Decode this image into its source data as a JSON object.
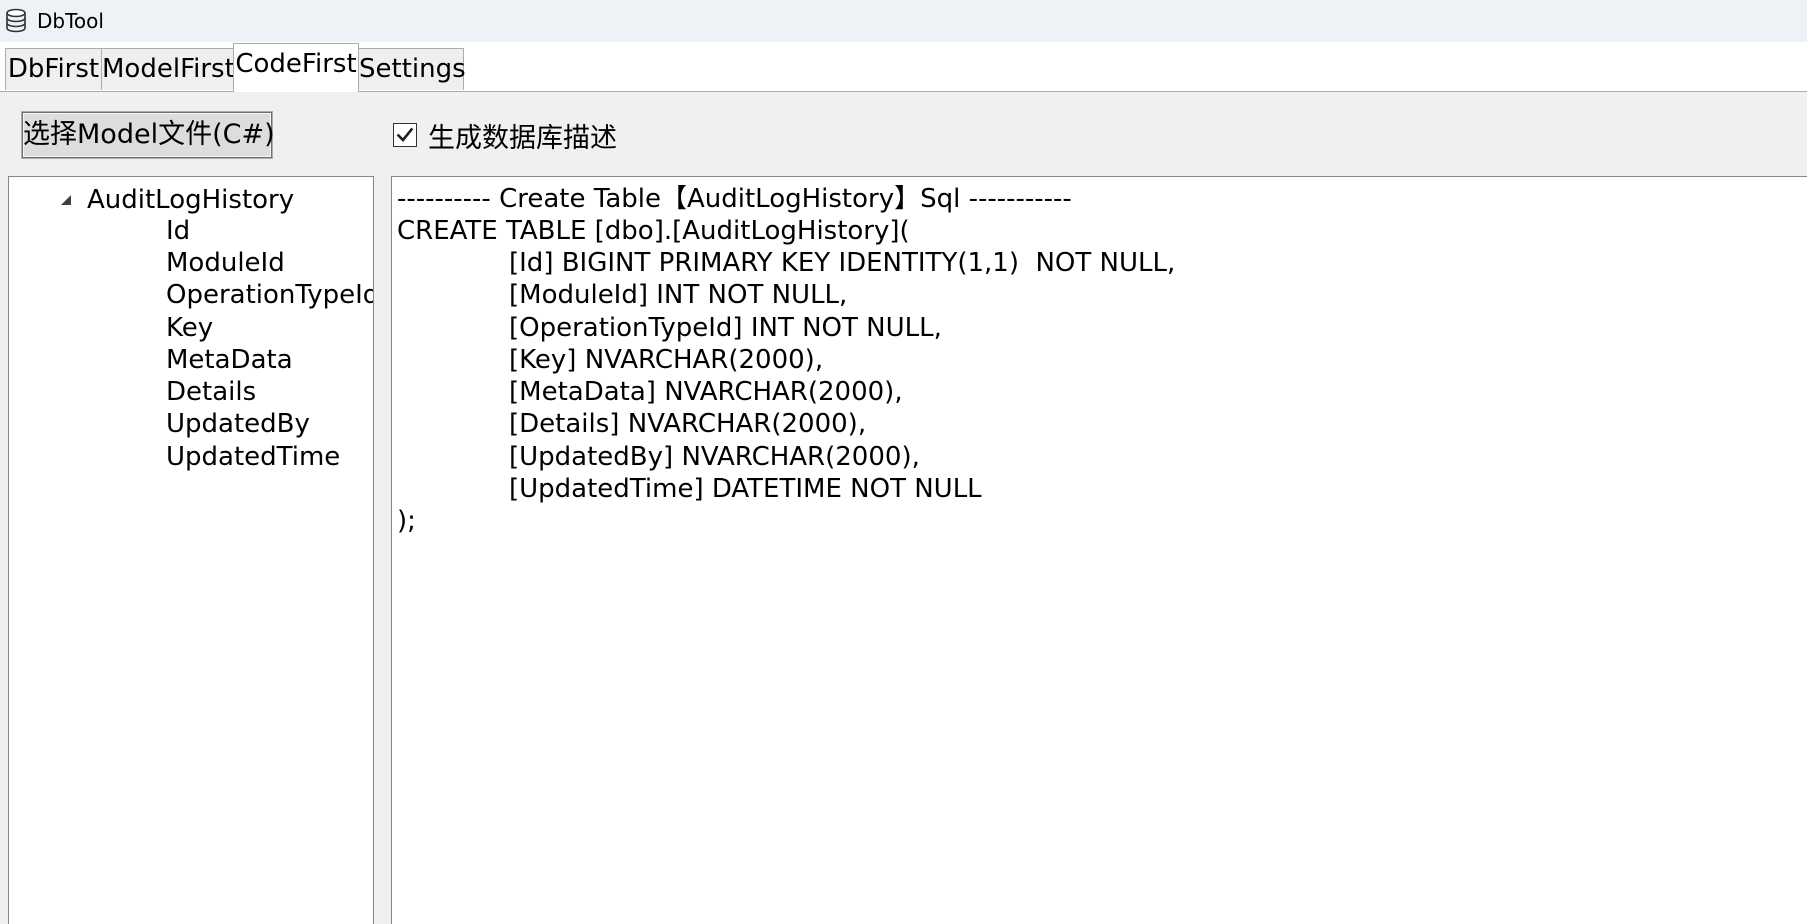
{
  "window": {
    "title": "DbTool",
    "icon": "database-stack-icon"
  },
  "tabs": [
    {
      "label": "DbFirst",
      "active": false
    },
    {
      "label": "ModelFirst",
      "active": false
    },
    {
      "label": "CodeFirst",
      "active": true
    },
    {
      "label": "Settings",
      "active": false
    }
  ],
  "toolbar": {
    "select_model_button": "选择Model文件(C#)",
    "generate_description_checkbox": {
      "label": "生成数据库描述",
      "checked": true
    }
  },
  "tree": {
    "root": {
      "label": "AuditLogHistory",
      "expanded": true,
      "children": [
        "Id",
        "ModuleId",
        "OperationTypeId",
        "Key",
        "MetaData",
        "Details",
        "UpdatedBy",
        "UpdatedTime"
      ]
    }
  },
  "sql_output": {
    "lines": [
      "---------- Create Table【AuditLogHistory】Sql -----------",
      "CREATE TABLE [dbo].[AuditLogHistory](",
      "[Id] BIGINT PRIMARY KEY IDENTITY(1,1)  NOT NULL,",
      "[ModuleId] INT NOT NULL,",
      "[OperationTypeId] INT NOT NULL,",
      "[Key] NVARCHAR(2000),",
      "[MetaData] NVARCHAR(2000),",
      "[Details] NVARCHAR(2000),",
      "[UpdatedBy] NVARCHAR(2000),",
      "[UpdatedTime] DATETIME NOT NULL",
      ");"
    ]
  }
}
